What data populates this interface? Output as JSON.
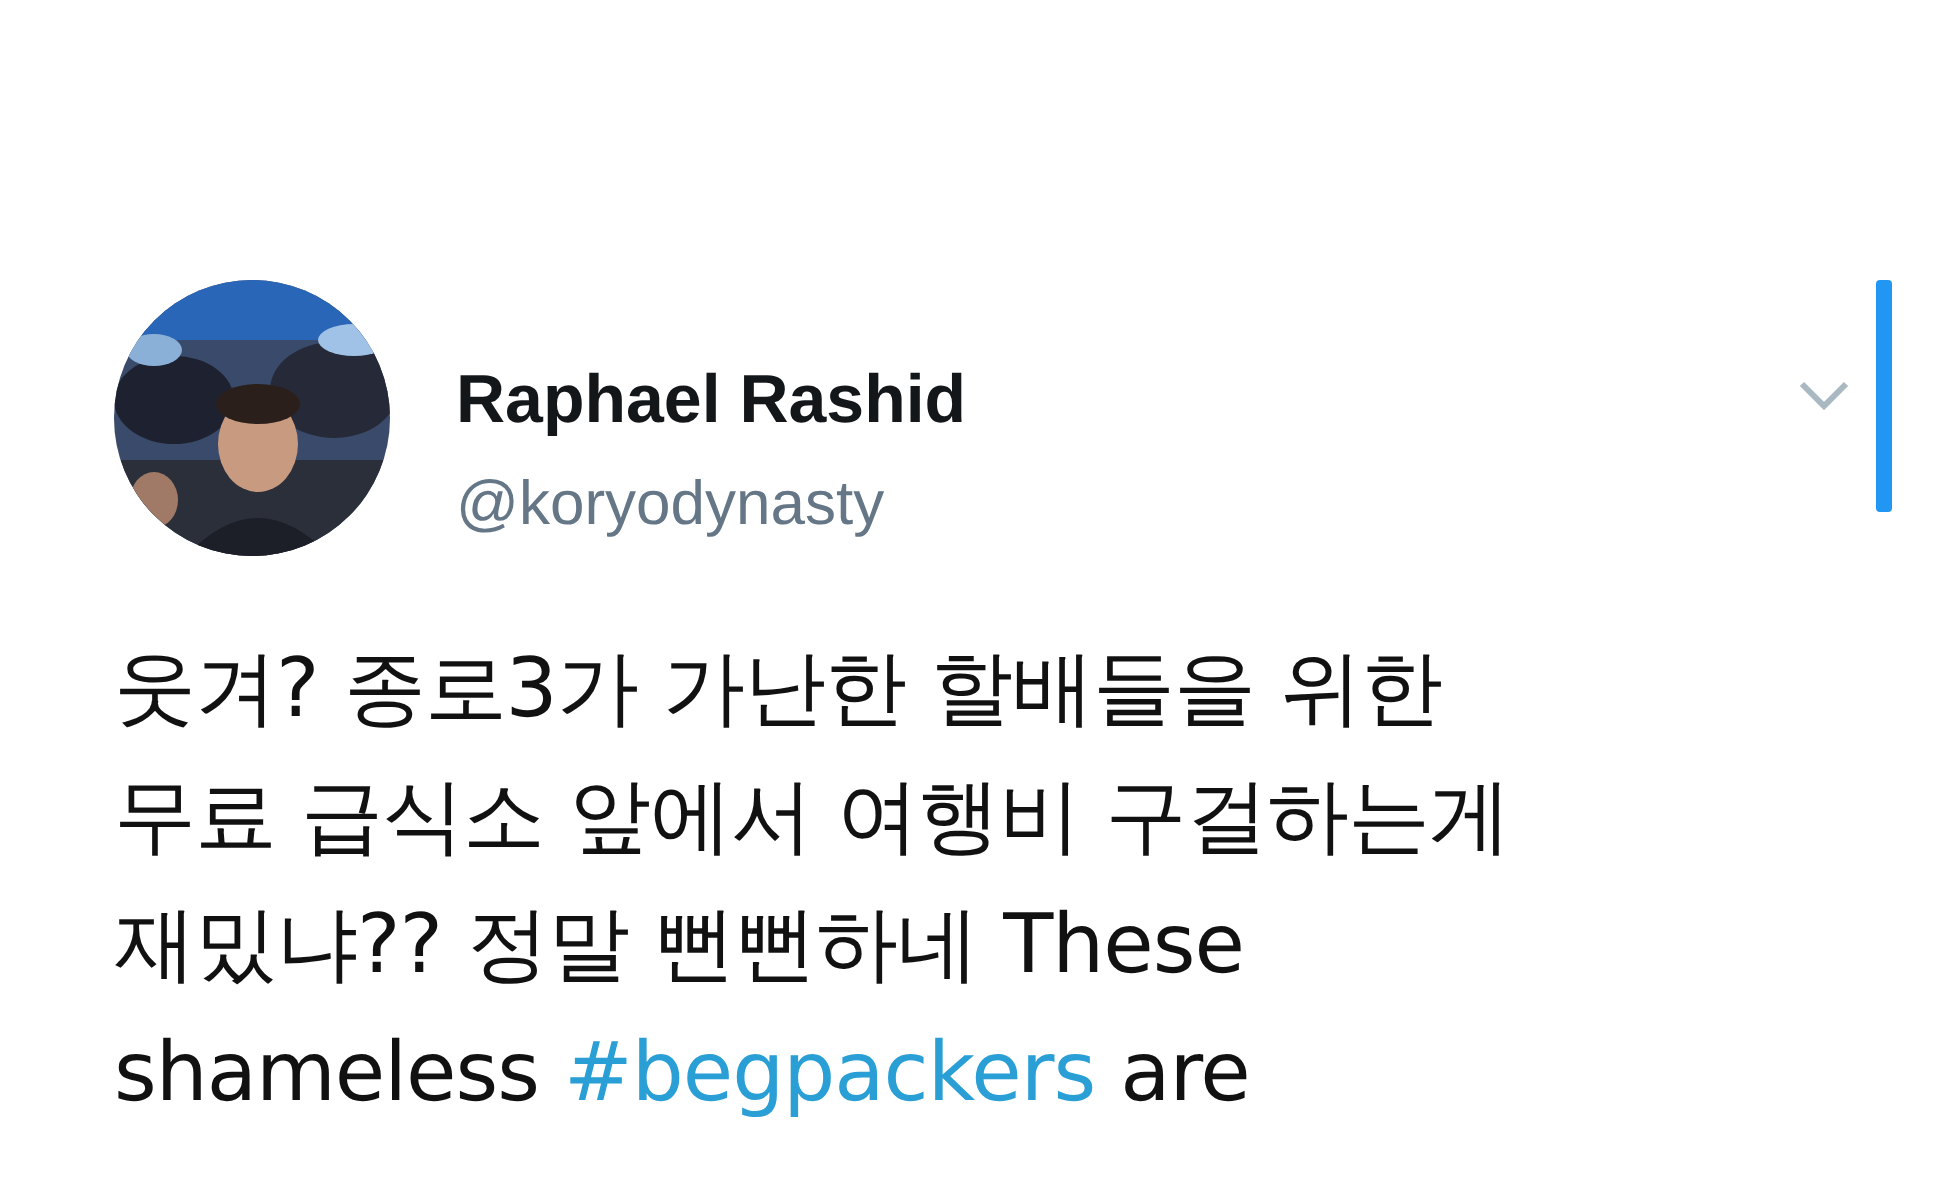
{
  "tweet": {
    "author": {
      "name": "Raphael Rashid",
      "handle": "@koryodynasty"
    },
    "menu": {
      "expanded": false
    },
    "text": [
      {
        "kind": "plain",
        "text": "웃겨? 종로3가 가난한 할배들을 위한\n무료 급식소 앞에서 여행비 구걸하는게\n재밌냐?? 정말 뻔뻔하네 These\nshameless "
      },
      {
        "kind": "hashtag",
        "text": "#begpackers"
      },
      {
        "kind": "plain",
        "text": " are"
      }
    ]
  }
}
